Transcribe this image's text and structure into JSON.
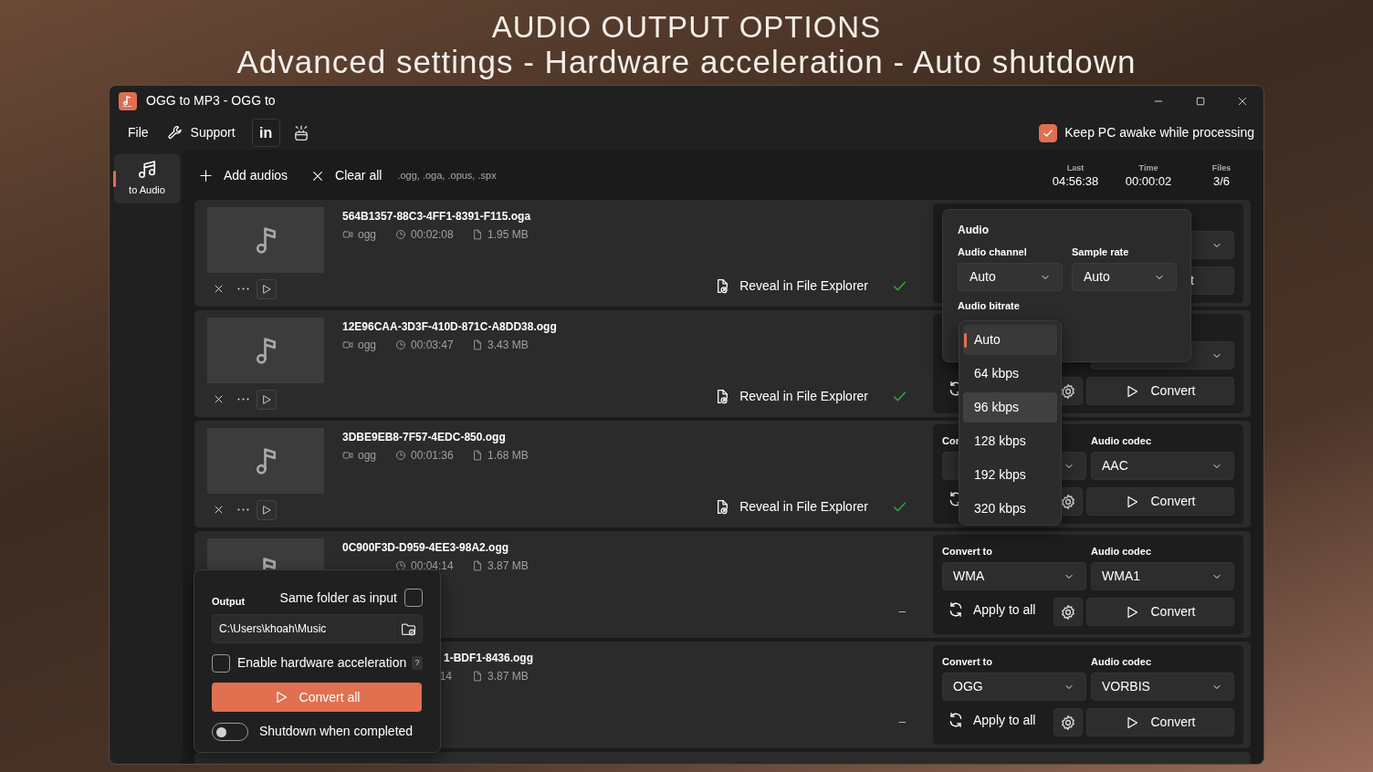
{
  "headline": [
    "AUDIO OUTPUT OPTIONS",
    "Advanced settings - Hardware acceleration - Auto shutdown"
  ],
  "window": {
    "title": "OGG to MP3 - OGG to"
  },
  "menu": [
    {
      "kind": "text",
      "label": "File"
    },
    {
      "kind": "support",
      "label": "Support"
    },
    {
      "kind": "social",
      "label": "in"
    },
    {
      "kind": "gift"
    }
  ],
  "keep_awake": {
    "label": "Keep PC awake while processing",
    "checked": true
  },
  "sidebar": {
    "items": [
      {
        "label": "to Audio",
        "selected": true
      }
    ]
  },
  "toolbar": {
    "add": "Add audios",
    "clear": "Clear all",
    "formats": ".ogg, .oga, .opus, .spx"
  },
  "stats": [
    {
      "label": "Last",
      "value": "04:56:38"
    },
    {
      "label": "Time",
      "value": "00:00:02"
    },
    {
      "label": "Files",
      "value": "3/6"
    }
  ],
  "files": [
    {
      "name": "564B1357-88C3-4FF1-8391-F115.oga",
      "thumbnail": true,
      "controls": true,
      "meta": [
        {
          "kind": "type",
          "text": "ogg"
        },
        {
          "kind": "duration",
          "text": "00:02:08"
        },
        {
          "kind": "size",
          "text": "1.95 MB"
        }
      ],
      "status": {
        "kind": "done",
        "label": "Reveal in File Explorer"
      },
      "settings": {
        "codec": {
          "kind": "dropdown"
        },
        "convert": {
          "label": "t",
          "cut": true
        }
      }
    },
    {
      "name": "12E96CAA-3D3F-410D-871C-A8DD38.ogg",
      "thumbnail": true,
      "controls": true,
      "meta": [
        {
          "kind": "type",
          "text": "ogg"
        },
        {
          "kind": "duration",
          "text": "00:03:47"
        },
        {
          "kind": "size",
          "text": "3.43 MB"
        }
      ],
      "status": {
        "kind": "done",
        "label": "Reveal in File Explorer"
      },
      "settings": {
        "codec": {
          "kind": "dropdown"
        },
        "apply": {
          "kind": "icon"
        },
        "gear": true,
        "convert": {
          "label": "Convert",
          "cut": false
        }
      }
    },
    {
      "name": "3DBE9EB8-7F57-4EDC-850.ogg",
      "thumbnail": true,
      "controls": true,
      "meta": [
        {
          "kind": "type",
          "text": "ogg"
        },
        {
          "kind": "duration",
          "text": "00:01:36"
        },
        {
          "kind": "size",
          "text": "1.68 MB"
        }
      ],
      "status": {
        "kind": "done",
        "label": "Reveal in File Explorer"
      },
      "settings": {
        "convert_to": {
          "kind": "dropdown",
          "label": "Cor"
        },
        "codec": {
          "kind": "dropdown",
          "label": "Audio codec",
          "value": "AAC"
        },
        "apply": {
          "kind": "icon"
        },
        "gear": true,
        "convert": {
          "label": "Convert",
          "cut": false
        }
      }
    },
    {
      "name": "0C900F3D-D959-4EE3-98A2.ogg",
      "thumbnail": true,
      "thumbnail_cut": true,
      "controls": false,
      "meta": [
        {
          "kind": "duration",
          "text": "00:04:14"
        },
        {
          "kind": "size",
          "text": "3.87 MB"
        }
      ],
      "status": {
        "kind": "pending",
        "label": "–"
      },
      "settings": {
        "convert_to": {
          "kind": "dropdown",
          "label": "Convert to",
          "value": "WMA"
        },
        "codec": {
          "kind": "dropdown",
          "label": "Audio codec",
          "value": "WMA1"
        },
        "apply": {
          "kind": "full",
          "label": "Apply to all"
        },
        "gear": true,
        "convert": {
          "label": "Convert",
          "cut": false
        }
      }
    },
    {
      "name": "1-BDF1-8436.ogg",
      "name_cut": true,
      "thumbnail": false,
      "controls": false,
      "meta": [
        {
          "kind": "duration",
          "text": "14",
          "cut": true
        },
        {
          "kind": "size",
          "text": "3.87 MB"
        }
      ],
      "status": {
        "kind": "pending",
        "label": "–"
      },
      "settings": {
        "convert_to": {
          "kind": "dropdown",
          "label": "Convert to",
          "value": "OGG"
        },
        "codec": {
          "kind": "dropdown",
          "label": "Audio codec",
          "value": "VORBIS"
        },
        "apply": {
          "kind": "full",
          "label": "Apply to all"
        },
        "gear": true,
        "convert": {
          "label": "Convert",
          "cut": false
        }
      }
    }
  ],
  "audio_popup": {
    "title": "Audio",
    "fields": [
      {
        "label": "Audio channel",
        "value": "Auto"
      },
      {
        "label": "Sample rate",
        "value": "Auto"
      }
    ],
    "bitrate_label": "Audio bitrate"
  },
  "bitrate_menu": [
    {
      "label": "Auto",
      "selected": true,
      "highlighted": false
    },
    {
      "label": "64 kbps",
      "selected": false,
      "highlighted": false
    },
    {
      "label": "96 kbps",
      "selected": false,
      "highlighted": true
    },
    {
      "label": "128 kbps",
      "selected": false,
      "highlighted": false
    },
    {
      "label": "192 kbps",
      "selected": false,
      "highlighted": false
    },
    {
      "label": "320 kbps",
      "selected": false,
      "highlighted": false
    }
  ],
  "output_popup": {
    "title": "Output",
    "same_folder": {
      "label": "Same folder as input",
      "checked": false
    },
    "path": "C:\\Users\\khoah\\Music",
    "hw_accel": {
      "label": "Enable hardware acceleration",
      "checked": false,
      "help": "?"
    },
    "convert_all": "Convert all",
    "shutdown": {
      "label": "Shutdown when completed",
      "on": false
    }
  }
}
